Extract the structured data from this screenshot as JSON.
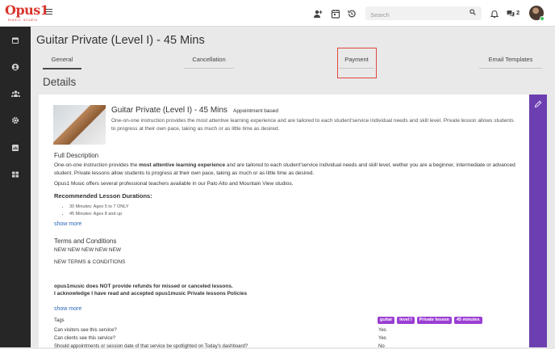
{
  "brand": {
    "logo_text": "Opus1",
    "logo_sub": "music studio",
    "accent": "#d9342b"
  },
  "header": {
    "search_placeholder": "Search",
    "message_count": "2",
    "icons": [
      "add-user-icon",
      "calendar-icon",
      "history-icon",
      "bell-icon",
      "chat-icon"
    ]
  },
  "sidebar": {
    "icons": [
      "calendar-icon",
      "user-icon",
      "users-icon",
      "gear-icon",
      "chart-icon",
      "grid-icon"
    ]
  },
  "page": {
    "title": "Guitar Private (Level I) - 45 Mins",
    "section_title": "Details"
  },
  "tabs": [
    {
      "label": "General",
      "active": true
    },
    {
      "label": "Cancellation",
      "active": false
    },
    {
      "label": "Payment",
      "active": false
    },
    {
      "label": "Email Templates",
      "active": false
    }
  ],
  "service": {
    "name": "Guitar Private (Level I) - 45 Mins",
    "type": "Appointment based",
    "short_description": "One-on-one instruction provides the most attentive learning experience and are tailored to each student'service individual needs and skill level. Private lesson allows students to progress at their own pace, taking as much or as little time as desired.",
    "full_description_heading": "Full Description",
    "full_desc_pre": "One-on-one instruction provides the ",
    "full_desc_bold": "most attentive learning experience",
    "full_desc_post": " and are tailored to each student'service individual needs and skill level, wether you are a beginner, intermediate or advanced student. Private lessons allow students to progress at their own pace, taking as much or as little time as desired.",
    "full_desc_p2": "Opus1 Music offers several professional teachers available in our Palo Alto and Mountain View studios.",
    "durations_heading": "Recommended Lesson Durations:",
    "durations": [
      "30 Minutes: Ages 5 to 7 ONLY",
      "45 Minutes: Ages 8 and up"
    ],
    "show_more": "show more",
    "terms_heading": "Terms and Conditions",
    "terms_line1": "NEW NEW NEW NEW NEW",
    "terms_line2": "NEW TERMS & CONDITIONS",
    "terms_bold1": "opus1music does NOT provide refunds for missed or canceled lessons.",
    "terms_bold2": "I acknowledge I have read and accepted opus1music Private lessons Policies",
    "tags_label": "Tags",
    "tags": [
      "guitar",
      "level I",
      "Private lesson",
      "45 minutes"
    ],
    "q1": "Can visitors see this service?",
    "a1": "Yes",
    "q2": "Can clients see this service?",
    "a2": "Yes",
    "q3": "Should appointments or session date of that service be spotlighted on Today's dashboard?",
    "a3": "No"
  },
  "colors": {
    "tag": "#9b3fd4",
    "edit_bar": "#6c3fb0",
    "highlight": "#e0473c",
    "link": "#2a65b8"
  }
}
